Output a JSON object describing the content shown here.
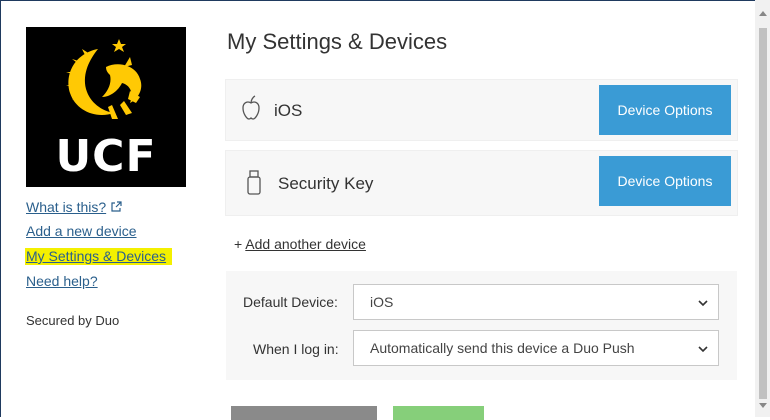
{
  "sidebar": {
    "logo_text": "UCF",
    "links": [
      {
        "label": "What is this?"
      },
      {
        "label": "Add a new device"
      },
      {
        "label": "My Settings & Devices"
      },
      {
        "label": "Need help?"
      }
    ],
    "secured_by": "Secured by Duo"
  },
  "main": {
    "title": "My Settings & Devices",
    "devices": [
      {
        "label": "iOS",
        "icon": "apple-icon",
        "button": "Device Options"
      },
      {
        "label": "Security Key",
        "icon": "usb-key-icon",
        "button": "Device Options"
      }
    ],
    "add_device_prefix": "+ ",
    "add_device_link": "Add another device",
    "settings": {
      "default_device_label": "Default Device:",
      "default_device_value": "iOS",
      "when_login_label": "When I log in:",
      "when_login_value": "Automatically send this device a Duo Push"
    }
  },
  "colors": {
    "accent": "#3a9bd5",
    "link": "#2a5f8c",
    "highlight": "#f4f000",
    "logo_gold": "#ffc904"
  }
}
